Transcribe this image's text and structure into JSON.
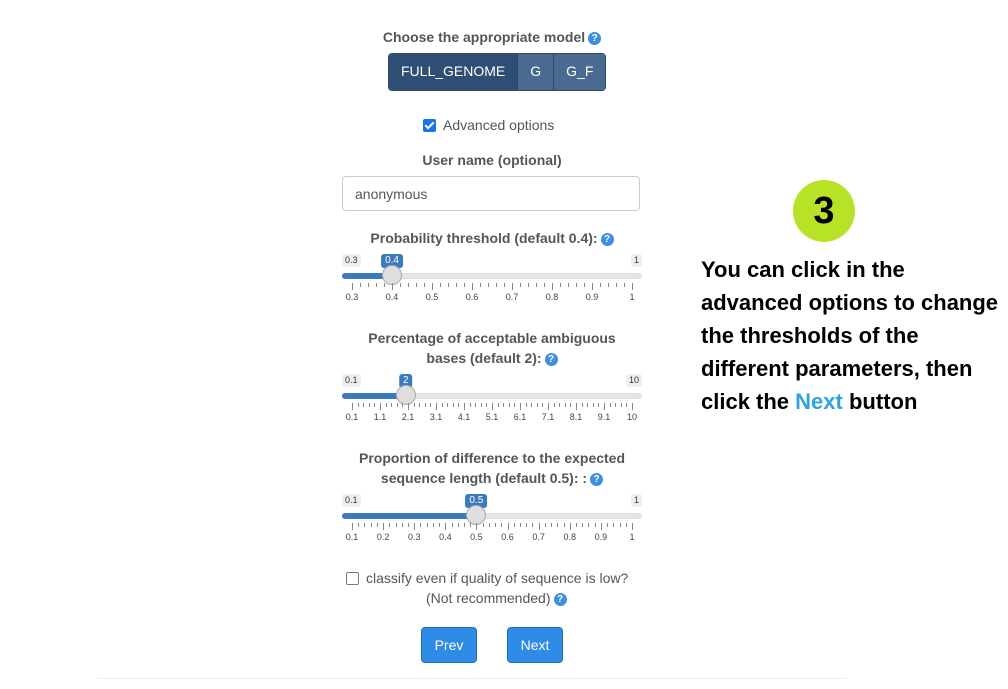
{
  "model": {
    "label": "Choose the appropriate model",
    "options": [
      "FULL_GENOME",
      "G",
      "G_F"
    ],
    "selected": "FULL_GENOME"
  },
  "advanced": {
    "label": "Advanced options",
    "checked": true
  },
  "username": {
    "label": "User name (optional)",
    "value": "anonymous"
  },
  "sliders": [
    {
      "label": "Probability threshold (default 0.4):",
      "min": "0.3",
      "max": "1",
      "value": "0.4",
      "value_fraction": 0.143,
      "ticks": [
        "0.3",
        "0.4",
        "0.5",
        "0.6",
        "0.7",
        "0.8",
        "0.9",
        "1"
      ]
    },
    {
      "label": "Percentage of acceptable ambiguous bases (default 2):",
      "min": "0.1",
      "max": "10",
      "value": "2",
      "value_fraction": 0.192,
      "ticks": [
        "0.1",
        "1.1",
        "2.1",
        "3.1",
        "4.1",
        "5.1",
        "6.1",
        "7.1",
        "8.1",
        "9.1",
        "10"
      ]
    },
    {
      "label": "Proportion of difference to the expected sequence length (default 0.5): :",
      "min": "0.1",
      "max": "1",
      "value": "0.5",
      "value_fraction": 0.444,
      "ticks": [
        "0.1",
        "0.2",
        "0.3",
        "0.4",
        "0.5",
        "0.6",
        "0.7",
        "0.8",
        "0.9",
        "1"
      ]
    }
  ],
  "low_quality": {
    "label": "classify even if quality of sequence is low?",
    "note": "(Not recommended)",
    "checked": false
  },
  "buttons": {
    "prev": "Prev",
    "next": "Next"
  },
  "annotation": {
    "step": "3",
    "text_before": "You can click in the advanced options to change the thresholds of the different parameters, then click the",
    "highlight": "Next",
    "text_after": "button"
  },
  "help_icon": "?",
  "colors": {
    "accent": "#2e8ce6",
    "model_active": "#2f4e74",
    "step_badge": "#b7e226",
    "highlight": "#2ea3e0"
  }
}
